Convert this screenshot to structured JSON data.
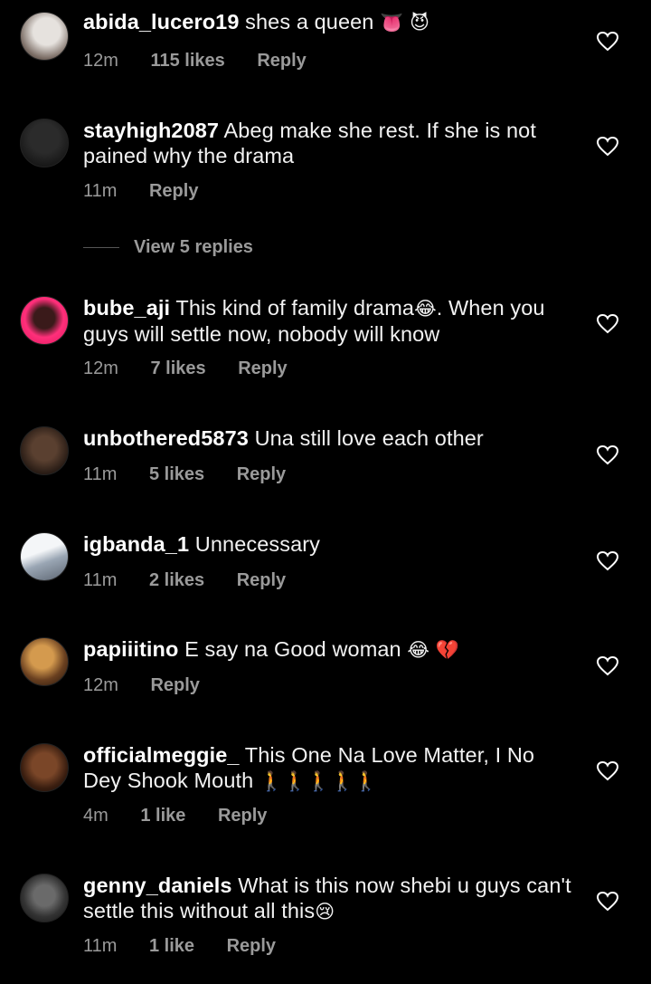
{
  "comments": [
    {
      "username": "abida_lucero19",
      "text": "shes a queen",
      "emoji": "👅 😈",
      "time": "12m",
      "likes": "115 likes",
      "reply": "Reply",
      "avatar_colors": [
        "#cfcfcf",
        "#8a7a70"
      ]
    },
    {
      "username": "stayhigh2087",
      "text": "Abeg make she rest.  If she is not pained why the drama",
      "emoji": "",
      "time": "11m",
      "likes": "",
      "reply": "Reply",
      "avatar_colors": [
        "#333333",
        "#0e0e0e"
      ]
    },
    {
      "username": "bube_aji",
      "text": "This kind of family drama",
      "emoji": "😂",
      "text2": ". When you guys will settle now, nobody will know",
      "time": "12m",
      "likes": "7 likes",
      "reply": "Reply",
      "avatar_colors": [
        "#ff2f7a",
        "#2a1010"
      ]
    },
    {
      "username": "unbothered5873",
      "text": "Una still love each other",
      "emoji": "",
      "time": "11m",
      "likes": "5 likes",
      "reply": "Reply",
      "avatar_colors": [
        "#4a3a30",
        "#1a1410"
      ]
    },
    {
      "username": "igbanda_1",
      "text": "Unnecessary",
      "emoji": "",
      "time": "11m",
      "likes": "2 likes",
      "reply": "Reply",
      "avatar_colors": [
        "#e8ebee",
        "#8a97a8"
      ]
    },
    {
      "username": "papiiitino",
      "text": "E say na Good woman",
      "emoji": "😂 💔",
      "time": "12m",
      "likes": "",
      "reply": "Reply",
      "avatar_colors": [
        "#c88a40",
        "#2b1a10"
      ]
    },
    {
      "username": "officialmeggie_",
      "text": "This One Na Love Matter, I No Dey Shook Mouth",
      "emoji": "🚶🚶🚶🚶🚶",
      "time": "4m",
      "likes": "1 like",
      "reply": "Reply",
      "avatar_colors": [
        "#6a3a22",
        "#1b0e08"
      ]
    },
    {
      "username": "genny_daniels",
      "text": "What is this now shebi u guys can't settle this without all this",
      "emoji": "😢",
      "time": "11m",
      "likes": "1 like",
      "reply": "Reply",
      "avatar_colors": [
        "#555555",
        "#161616"
      ]
    }
  ],
  "view_replies": "View 5 replies",
  "icons": {
    "like": "heart-icon"
  },
  "colors": {
    "background": "#000000",
    "muted": "#9a9a9a",
    "text": "#f2f2f2"
  }
}
